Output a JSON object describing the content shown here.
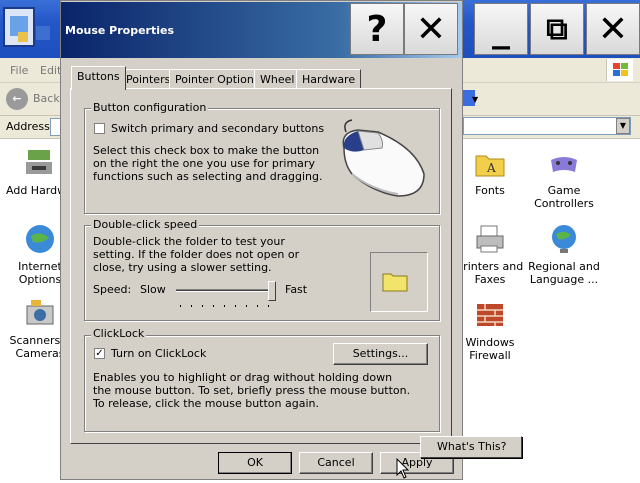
{
  "background": {
    "menu": {
      "file": "File",
      "edit": "Edit"
    },
    "toolbar": {
      "back": "Back"
    },
    "address_label": "Address",
    "items": [
      {
        "label": "Add Hardwa"
      },
      {
        "label": "Internet Options"
      },
      {
        "label": "Scanners a Cameras"
      },
      {
        "label": "Fonts"
      },
      {
        "label": "Game Controllers"
      },
      {
        "label": "Printers and Faxes"
      },
      {
        "label": "Regional and Language ..."
      },
      {
        "label": "Windows Firewall"
      }
    ]
  },
  "dialog": {
    "title": "Mouse Properties",
    "title_buttons": {
      "help": "?",
      "close": "✕",
      "minimize": "_",
      "restore": "⧉",
      "bg_close": "✕"
    },
    "tabs": [
      {
        "label": "Buttons"
      },
      {
        "label": "Pointers"
      },
      {
        "label": "Pointer Options"
      },
      {
        "label": "Wheel"
      },
      {
        "label": "Hardware"
      }
    ],
    "button_config": {
      "legend": "Button configuration",
      "switch_label": "Switch primary and secondary buttons",
      "checked": false,
      "description": "Select this check box to make the button on the right the one you use for primary functions such as selecting and dragging."
    },
    "double_click": {
      "legend": "Double-click speed",
      "description": "Double-click the folder to test your setting. If the folder does not open or close, try using a slower setting.",
      "speed_label": "Speed:",
      "slow_label": "Slow",
      "fast_label": "Fast",
      "slider_value": 1.0
    },
    "clicklock": {
      "legend": "ClickLock",
      "turn_on_label": "Turn on ClickLock",
      "checked": true,
      "settings_button": "Settings...",
      "description": "Enables you to highlight or drag without holding down the mouse button. To set, briefly press the mouse button. To release, click the mouse button again."
    },
    "buttons": {
      "ok": "OK",
      "cancel": "Cancel",
      "apply": "Apply"
    },
    "context_menu": {
      "whats_this": "What's This?"
    }
  }
}
